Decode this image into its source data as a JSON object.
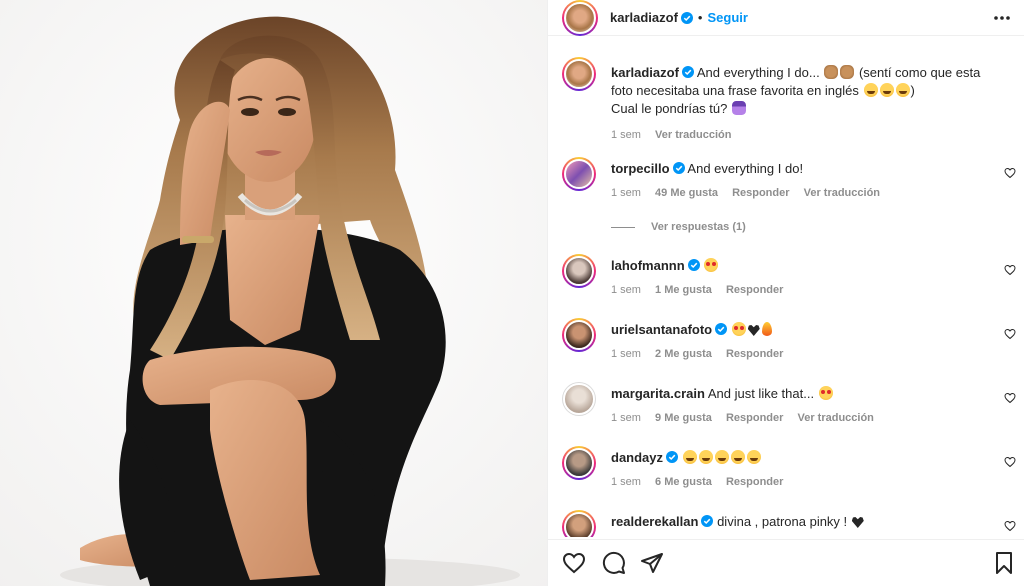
{
  "post": {
    "author": "karladiazof",
    "follow_label": "Seguir",
    "dot": "•"
  },
  "caption": {
    "username": "karladiazof",
    "text_part1": "And everything I do...",
    "text_part2": "(sentí como que esta foto necesitaba una frase favorita en inglés",
    "text_part3": ")",
    "text_line2": "Cual le pondrías tú?",
    "time": "1 sem",
    "translate": "Ver traducción"
  },
  "comments": [
    {
      "username": "torpecillo",
      "verified": true,
      "text": "And everything I do!",
      "time": "1 sem",
      "likes": "49 Me gusta",
      "reply": "Responder",
      "translate": "Ver traducción"
    },
    {
      "username": "lahofmannn",
      "verified": true,
      "text": "",
      "time": "1 sem",
      "likes": "1 Me gusta",
      "reply": "Responder"
    },
    {
      "username": "urielsantanafoto",
      "verified": true,
      "text": "",
      "time": "1 sem",
      "likes": "2 Me gusta",
      "reply": "Responder"
    },
    {
      "username": "margarita.crain",
      "verified": false,
      "text": "And just like that...",
      "time": "1 sem",
      "likes": "9 Me gusta",
      "reply": "Responder",
      "translate": "Ver traducción"
    },
    {
      "username": "dandayz",
      "verified": true,
      "text": "",
      "time": "1 sem",
      "likes": "6 Me gusta",
      "reply": "Responder"
    },
    {
      "username": "realderekallan",
      "verified": true,
      "text": "divina , patrona pinky !",
      "time": "",
      "likes": "",
      "reply": ""
    }
  ],
  "view_replies": "Ver respuestas (1)",
  "icons": {
    "header": [
      "verified-badge-icon",
      "more-options-icon"
    ],
    "actions": [
      "heart-icon",
      "comment-icon",
      "share-icon",
      "bookmark-icon"
    ]
  },
  "colors": {
    "accent": "#0095f6",
    "verified": "#0095f6",
    "muted": "#8e8e8e",
    "text": "#262626",
    "divider": "#efefef"
  }
}
